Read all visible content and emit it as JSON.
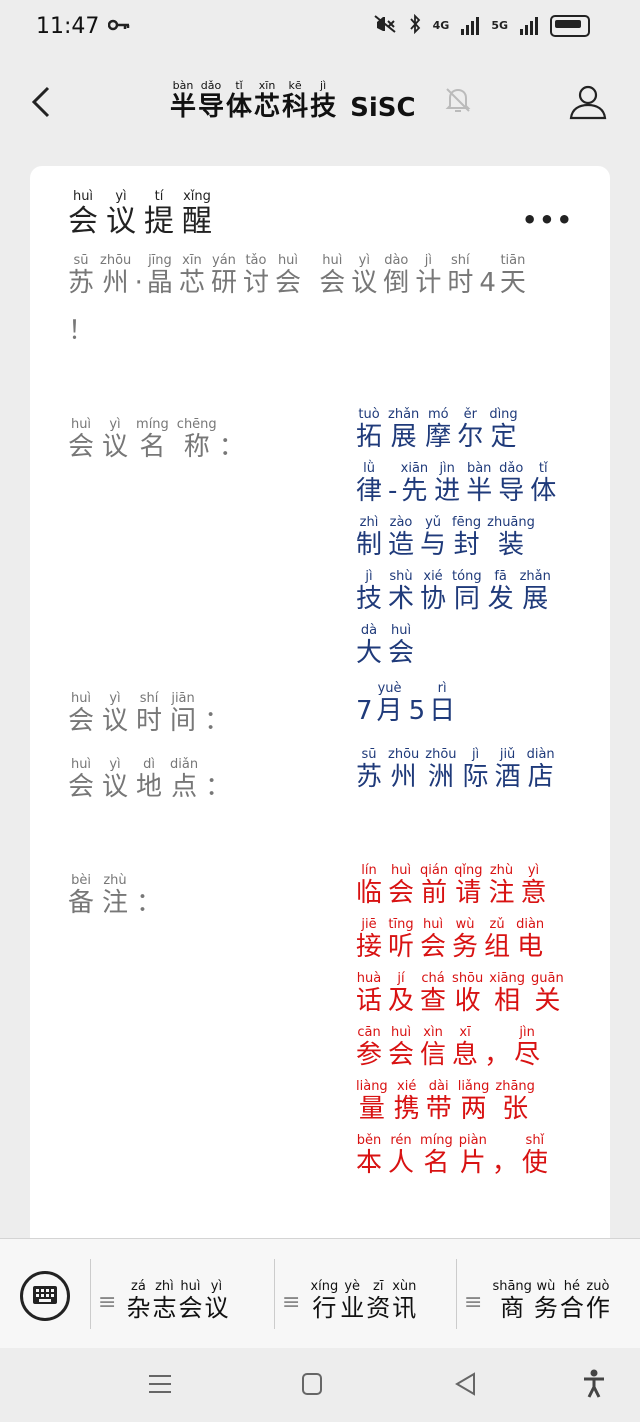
{
  "status_bar": {
    "time": "11:47",
    "network_1": "4G",
    "network_2": "5G",
    "icons": [
      "key-icon",
      "mute-icon",
      "bluetooth-icon",
      "signal-icon",
      "battery-icon"
    ]
  },
  "header": {
    "title_chars": [
      {
        "h": "半",
        "p": "bàn"
      },
      {
        "h": "导",
        "p": "dǎo"
      },
      {
        "h": "体",
        "p": "tǐ"
      },
      {
        "h": "芯",
        "p": "xīn"
      },
      {
        "h": "科",
        "p": "kē"
      },
      {
        "h": "技",
        "p": "jì"
      }
    ],
    "title_latin": "SiSC"
  },
  "card": {
    "title_chars": [
      {
        "h": "会",
        "p": "huì"
      },
      {
        "h": "议",
        "p": "yì"
      },
      {
        "h": "提",
        "p": "tí"
      },
      {
        "h": "醒",
        "p": "xǐng"
      }
    ],
    "more": "•••",
    "countdown_chars": [
      {
        "h": "苏",
        "p": "sū"
      },
      {
        "h": "州",
        "p": "zhōu"
      },
      {
        "h": "·",
        "p": ""
      },
      {
        "h": "晶",
        "p": "jīng"
      },
      {
        "h": "芯",
        "p": "xīn"
      },
      {
        "h": "研",
        "p": "yán"
      },
      {
        "h": "讨",
        "p": "tǎo"
      },
      {
        "h": "会",
        "p": "huì"
      },
      {
        "h": " ",
        "p": ""
      },
      {
        "h": "会",
        "p": "huì"
      },
      {
        "h": "议",
        "p": "yì"
      },
      {
        "h": "倒",
        "p": "dào"
      },
      {
        "h": "计",
        "p": "jì"
      },
      {
        "h": "时",
        "p": "shí"
      },
      {
        "h": "4",
        "p": ""
      },
      {
        "h": "天",
        "p": "tiān"
      },
      {
        "h": " ！",
        "p": ""
      }
    ],
    "rows": [
      {
        "label_chars": [
          {
            "h": "会",
            "p": "huì"
          },
          {
            "h": "议",
            "p": "yì"
          },
          {
            "h": "名",
            "p": "míng"
          },
          {
            "h": "称",
            "p": "chēng"
          }
        ],
        "colon": "：",
        "value_chars": [
          {
            "h": "拓",
            "p": "tuò"
          },
          {
            "h": "展",
            "p": "zhǎn"
          },
          {
            "h": "摩",
            "p": "mó"
          },
          {
            "h": "尔",
            "p": "ěr"
          },
          {
            "h": "定",
            "p": "dìng"
          },
          {
            "h": "律",
            "p": "lǜ"
          },
          {
            "h": "-",
            "p": ""
          },
          {
            "h": "先",
            "p": "xiān"
          },
          {
            "h": "进",
            "p": "jìn"
          },
          {
            "h": "半",
            "p": "bàn"
          },
          {
            "h": "导",
            "p": "dǎo"
          },
          {
            "h": "体",
            "p": "tǐ"
          },
          {
            "h": "制",
            "p": "zhì"
          },
          {
            "h": "造",
            "p": "zào"
          },
          {
            "h": "与",
            "p": "yǔ"
          },
          {
            "h": "封",
            "p": "fēng"
          },
          {
            "h": "装",
            "p": "zhuāng"
          },
          {
            "h": "技",
            "p": "jì"
          },
          {
            "h": "术",
            "p": "shù"
          },
          {
            "h": "协",
            "p": "xié"
          },
          {
            "h": "同",
            "p": "tóng"
          },
          {
            "h": "发",
            "p": "fā"
          },
          {
            "h": "展",
            "p": "zhǎn"
          },
          {
            "h": "大",
            "p": "dà"
          },
          {
            "h": "会",
            "p": "huì"
          }
        ]
      },
      {
        "label_chars": [
          {
            "h": "会",
            "p": "huì"
          },
          {
            "h": "议",
            "p": "yì"
          },
          {
            "h": "时",
            "p": "shí"
          },
          {
            "h": "间",
            "p": "jiān"
          }
        ],
        "colon": "：",
        "value_chars": [
          {
            "h": "7",
            "p": ""
          },
          {
            "h": "月",
            "p": "yuè"
          },
          {
            "h": "5",
            "p": ""
          },
          {
            "h": "日",
            "p": "rì"
          }
        ]
      },
      {
        "label_chars": [
          {
            "h": "会",
            "p": "huì"
          },
          {
            "h": "议",
            "p": "yì"
          },
          {
            "h": "地",
            "p": "dì"
          },
          {
            "h": "点",
            "p": "diǎn"
          }
        ],
        "colon": "：",
        "value_chars": [
          {
            "h": "苏",
            "p": "sū"
          },
          {
            "h": "州",
            "p": "zhōu"
          },
          {
            "h": "洲",
            "p": "zhōu"
          },
          {
            "h": "际",
            "p": "jì"
          },
          {
            "h": "酒",
            "p": "jiǔ"
          },
          {
            "h": "店",
            "p": "diàn"
          }
        ]
      },
      {
        "label_chars": [
          {
            "h": "备",
            "p": "bèi"
          },
          {
            "h": "注",
            "p": "zhù"
          }
        ],
        "colon": "：",
        "value_chars": [
          {
            "h": "临",
            "p": "lín"
          },
          {
            "h": "会",
            "p": "huì"
          },
          {
            "h": "前",
            "p": "qián"
          },
          {
            "h": "请",
            "p": "qǐng"
          },
          {
            "h": "注",
            "p": "zhù"
          },
          {
            "h": "意",
            "p": "yì"
          },
          {
            "h": "接",
            "p": "jiē"
          },
          {
            "h": "听",
            "p": "tīng"
          },
          {
            "h": "会",
            "p": "huì"
          },
          {
            "h": "务",
            "p": "wù"
          },
          {
            "h": "组",
            "p": "zǔ"
          },
          {
            "h": "电",
            "p": "diàn"
          },
          {
            "h": "话",
            "p": "huà"
          },
          {
            "h": "及",
            "p": "jí"
          },
          {
            "h": "查",
            "p": "chá"
          },
          {
            "h": "收",
            "p": "shōu"
          },
          {
            "h": "相",
            "p": "xiāng"
          },
          {
            "h": "关",
            "p": "guān"
          },
          {
            "h": "参",
            "p": "cān"
          },
          {
            "h": "会",
            "p": "huì"
          },
          {
            "h": "信",
            "p": "xìn"
          },
          {
            "h": "息",
            "p": "xī"
          },
          {
            "h": "，",
            "p": ""
          },
          {
            "h": "尽",
            "p": "jìn"
          },
          {
            "h": "量",
            "p": "liàng"
          },
          {
            "h": "携",
            "p": "xié"
          },
          {
            "h": "带",
            "p": "dài"
          },
          {
            "h": "两",
            "p": "liǎng"
          },
          {
            "h": "张",
            "p": "zhāng"
          },
          {
            "h": "本",
            "p": "běn"
          },
          {
            "h": "人",
            "p": "rén"
          },
          {
            "h": "名",
            "p": "míng"
          },
          {
            "h": "片",
            "p": "piàn"
          },
          {
            "h": "，",
            "p": ""
          },
          {
            "h": "使",
            "p": "shǐ"
          }
        ]
      }
    ]
  },
  "menu": {
    "items": [
      {
        "chars": [
          {
            "h": "杂",
            "p": "zá"
          },
          {
            "h": "志",
            "p": "zhì"
          },
          {
            "h": "会",
            "p": "huì"
          },
          {
            "h": "议",
            "p": "yì"
          }
        ]
      },
      {
        "chars": [
          {
            "h": "行",
            "p": "xíng"
          },
          {
            "h": "业",
            "p": "yè"
          },
          {
            "h": "资",
            "p": "zī"
          },
          {
            "h": "讯",
            "p": "xùn"
          }
        ]
      },
      {
        "chars": [
          {
            "h": "商",
            "p": "shāng"
          },
          {
            "h": "务",
            "p": "wù"
          },
          {
            "h": "合",
            "p": "hé"
          },
          {
            "h": "作",
            "p": "zuò"
          }
        ]
      }
    ]
  },
  "colors": {
    "value_navy": "#1f3a7a",
    "note_red": "#d81212",
    "label_gray": "#777777"
  }
}
